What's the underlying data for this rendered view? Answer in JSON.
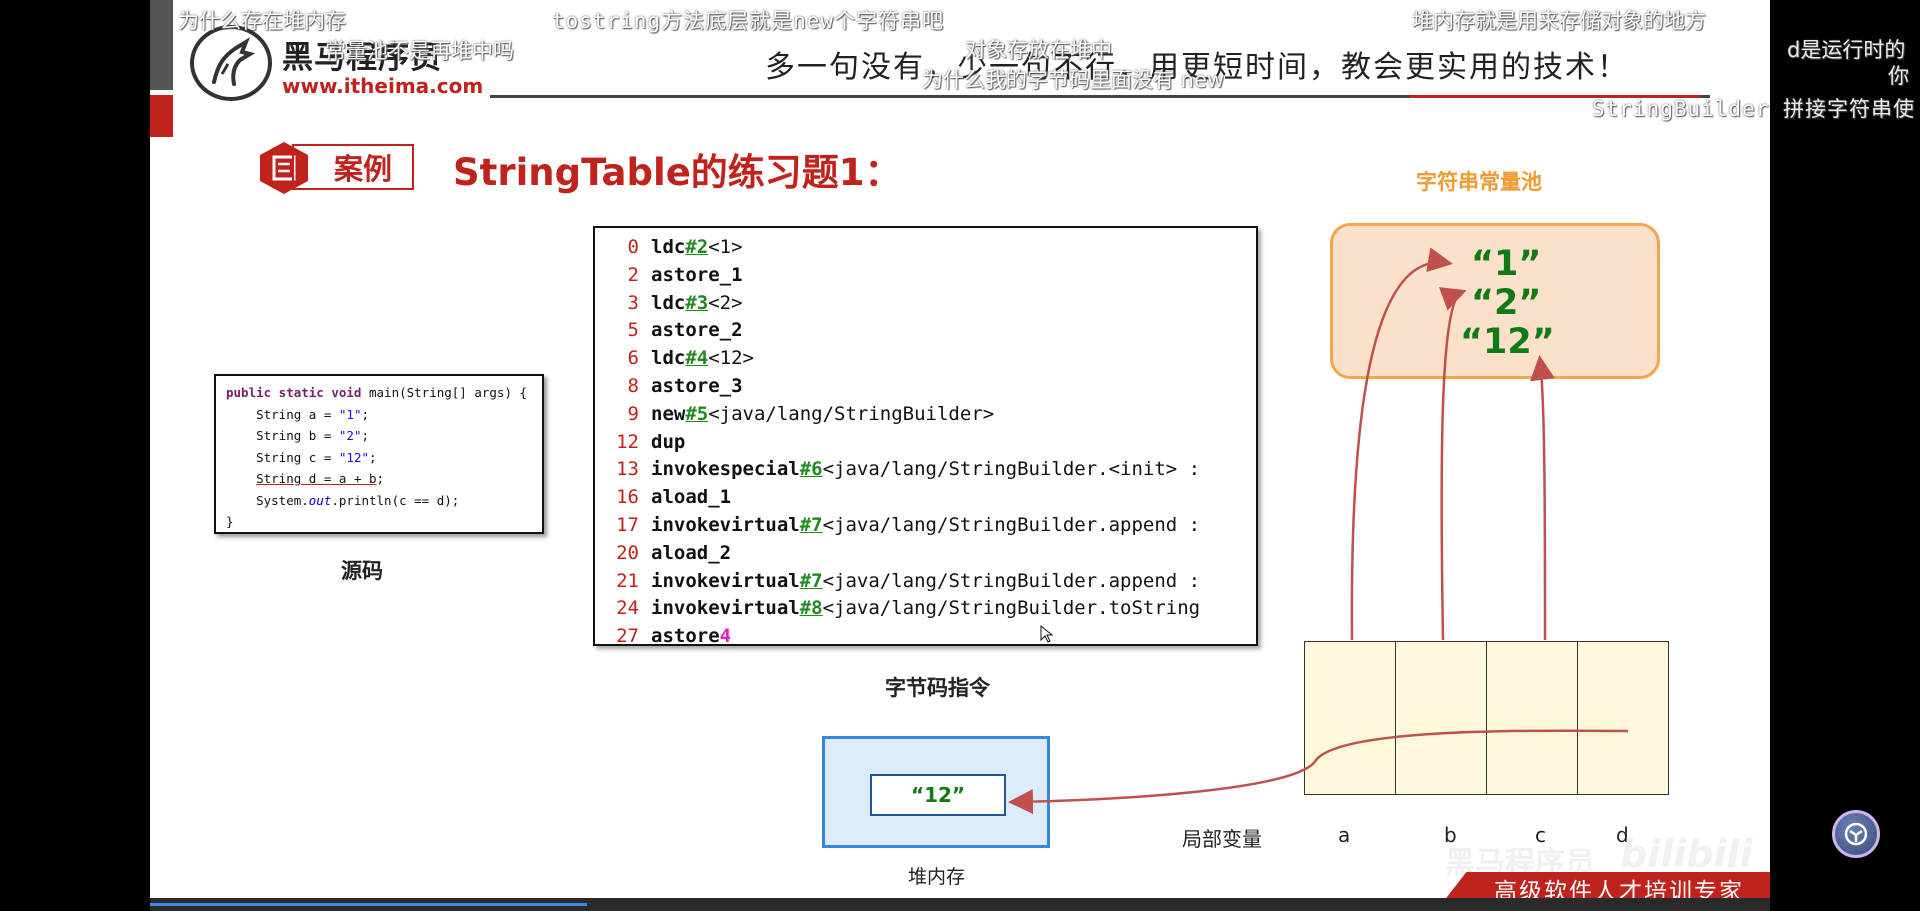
{
  "logo": {
    "title": "黑马程序员",
    "url": "www.itheima.com"
  },
  "slogan": "多一句没有，少一句不行，用更短时间，教会更实用的技术！",
  "case_badge": "案例",
  "slide_title": "StringTable的练习题1：",
  "source_code": {
    "label": "源码",
    "lines": [
      "public static void main(String[] args) {",
      "    String a = \"1\";",
      "    String b = \"2\";",
      "    String c = \"12\";",
      "    String d = a + b;",
      "    System.out.println(c == d);",
      "}"
    ]
  },
  "bytecode": {
    "label": "字节码指令",
    "rows": [
      {
        "num": "0",
        "op": "ldc",
        "ref": "#2",
        "rest": "<1>"
      },
      {
        "num": "2",
        "op": "astore_1",
        "ref": "",
        "rest": ""
      },
      {
        "num": "3",
        "op": "ldc",
        "ref": "#3",
        "rest": "<2>"
      },
      {
        "num": "5",
        "op": "astore_2",
        "ref": "",
        "rest": ""
      },
      {
        "num": "6",
        "op": "ldc",
        "ref": "#4",
        "rest": "<12>"
      },
      {
        "num": "8",
        "op": "astore_3",
        "ref": "",
        "rest": ""
      },
      {
        "num": "9",
        "op": "new",
        "ref": "#5",
        "rest": "<java/lang/StringBuilder>"
      },
      {
        "num": "12",
        "op": "dup",
        "ref": "",
        "rest": ""
      },
      {
        "num": "13",
        "op": "invokespecial",
        "ref": "#6",
        "rest": "<java/lang/StringBuilder.<init> :"
      },
      {
        "num": "16",
        "op": "aload_1",
        "ref": "",
        "rest": ""
      },
      {
        "num": "17",
        "op": "invokevirtual",
        "ref": "#7",
        "rest": "<java/lang/StringBuilder.append :"
      },
      {
        "num": "20",
        "op": "aload_2",
        "ref": "",
        "rest": ""
      },
      {
        "num": "21",
        "op": "invokevirtual",
        "ref": "#7",
        "rest": "<java/lang/StringBuilder.append :"
      },
      {
        "num": "24",
        "op": "invokevirtual",
        "ref": "#8",
        "rest": "<java/lang/StringBuilder.toString"
      },
      {
        "num": "27",
        "op": "astore",
        "ref": "",
        "rest": "",
        "val": "4"
      }
    ]
  },
  "string_pool": {
    "title": "字符串常量池",
    "items": [
      "“1”",
      "“2”",
      "“12”"
    ]
  },
  "locals": {
    "label": "局部变量",
    "names": [
      "a",
      "b",
      "c",
      "d"
    ]
  },
  "heap": {
    "label": "堆内存",
    "value": "“12”"
  },
  "danmaku": [
    "为什么存在堆内存",
    "tostring方法底层就是new个字符串吧",
    "堆内存就是用来存储对象的地方",
    "d是运行时的",
    "你",
    "常量池不是再堆中吗",
    "对象存放在堆中",
    "为什么我的字节码里面没有 new",
    "StringBuilder 拼接字符串使"
  ],
  "footer": "高级软件人才培训专家",
  "watermarks": [
    "黑马程序员",
    "bilibili"
  ],
  "video_progress": 0.27,
  "colors": {
    "brand_red": "#c0221c",
    "pool_orange": "#f19a32",
    "string_green": "#127a12",
    "heap_blue": "#2f88e8",
    "arrow_red": "#c0504d"
  }
}
